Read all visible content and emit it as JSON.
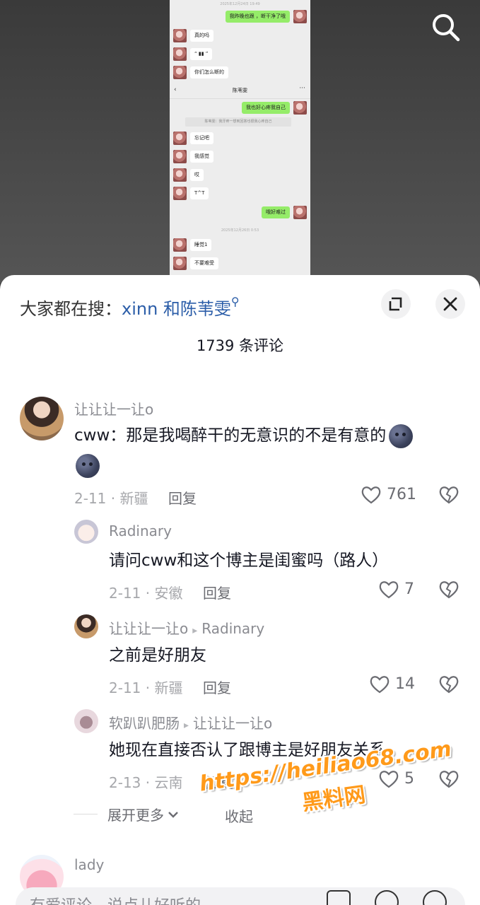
{
  "screenshot": {
    "stamp_top": "2025年12月24日 19:49",
    "stamp_bottom": "2025年12月26日 0:53",
    "chat_title": "陈苇雯",
    "system_line": "陈苇雯：我牙疼一想到回答也很我心疼自己",
    "messages_top": [
      {
        "side": "r",
        "text": "我昨晚也跟 ，断干净了哦"
      },
      {
        "side": "l",
        "text": "真的吗"
      },
      {
        "side": "l",
        "text": "“ ▮▮  ”"
      },
      {
        "side": "l",
        "text": "你们怎么断的"
      }
    ],
    "messages_bottom": [
      {
        "side": "r",
        "text": "我也好心疼我自己"
      },
      {
        "side": "l",
        "text": "忘记吧"
      },
      {
        "side": "l",
        "text": "我感觉"
      },
      {
        "side": "l",
        "text": "哎"
      },
      {
        "side": "l",
        "text": "T^T"
      },
      {
        "side": "r",
        "text": "哦好难过"
      },
      {
        "side": "l",
        "text": "睡觉1"
      },
      {
        "side": "l",
        "text": "不要难受"
      }
    ]
  },
  "sheet": {
    "hot_search_prefix": "大家都在搜：",
    "hot_search_keyword": "xinn 和陈苇雯",
    "comment_count": "1739 条评论",
    "reply_label": "回复",
    "expand_more": "展开更多",
    "collapse": "收起",
    "input_placeholder": "有爱评论，说点儿好听的"
  },
  "comments": {
    "c1": {
      "user": "让让让一让o",
      "text": "cww：那是我喝醉干的无意识的不是有意的",
      "date_region": "2-11 · 新疆",
      "likes": "761"
    },
    "r1": {
      "user": "Radinary",
      "text": "请问cww和这个博主是闺蜜吗（路人）",
      "date_region": "2-11 · 安徽",
      "likes": "7"
    },
    "r2": {
      "user": "让让让一让o",
      "reply_to": "Radinary",
      "text": "之前是好朋友",
      "date_region": "2-11 · 新疆",
      "likes": "14"
    },
    "r3": {
      "user": "软趴趴肥肠",
      "reply_to": "让让让一让o",
      "text": "她现在直接否认了跟博主是好朋友关系",
      "date_region": "2-13 · 云南",
      "likes": "5"
    },
    "c2": {
      "user": "lady"
    }
  },
  "watermark": {
    "url": "https://heiliao68.com",
    "name": "黑料网"
  },
  "icons": [
    "search-icon",
    "expand-icon",
    "close-icon",
    "heart-icon",
    "broken-heart-icon",
    "chevron-down-icon",
    "image-icon",
    "at-icon",
    "emoji-icon"
  ],
  "colors": {
    "keyword": "#2b5da8",
    "bubble_green": "#95ec69",
    "watermark": "#ff9a1a"
  }
}
